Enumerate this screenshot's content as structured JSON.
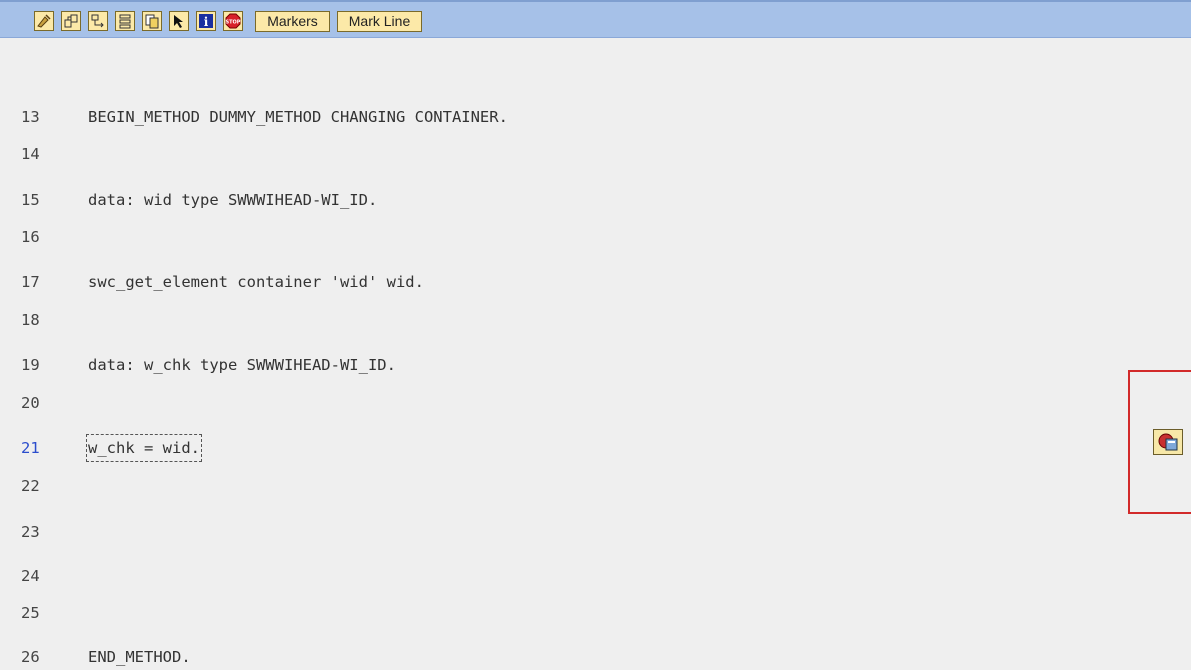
{
  "toolbar": {
    "icons": [
      {
        "name": "pretty-printer-icon"
      },
      {
        "name": "display-object-list-icon"
      },
      {
        "name": "navigation-window-icon"
      },
      {
        "name": "structure-icon"
      },
      {
        "name": "copy-icon"
      },
      {
        "name": "select-pointer-icon"
      },
      {
        "name": "info-icon"
      },
      {
        "name": "stop-icon"
      }
    ],
    "markers_label": "Markers",
    "mark_line_label": "Mark Line"
  },
  "editor": {
    "lines": [
      {
        "num": "13",
        "code": "BEGIN_METHOD DUMMY_METHOD CHANGING CONTAINER."
      },
      {
        "num": "14",
        "code": ""
      },
      {
        "num": "15",
        "code": "data: wid type SWWWIHEAD-WI_ID."
      },
      {
        "num": "16",
        "code": ""
      },
      {
        "num": "17",
        "code": "swc_get_element container 'wid' wid."
      },
      {
        "num": "18",
        "code": ""
      },
      {
        "num": "19",
        "code": "data: w_chk type SWWWIHEAD-WI_ID."
      },
      {
        "num": "20",
        "code": ""
      },
      {
        "num": "21",
        "code": "w_chk = wid."
      },
      {
        "num": "22",
        "code": ""
      },
      {
        "num": "23",
        "code": ""
      },
      {
        "num": "24",
        "code": ""
      },
      {
        "num": "25",
        "code": ""
      },
      {
        "num": "26",
        "code": "END_METHOD."
      }
    ],
    "current_line": "21"
  },
  "colors": {
    "toolbar_bg": "#a6c1e8",
    "button_bg": "#fce9a8",
    "editor_bg": "#efefef",
    "current_line_number": "#2b4dcc",
    "highlight_border": "#d22a2a"
  },
  "side_icon": {
    "name": "breakpoint-session-icon"
  }
}
